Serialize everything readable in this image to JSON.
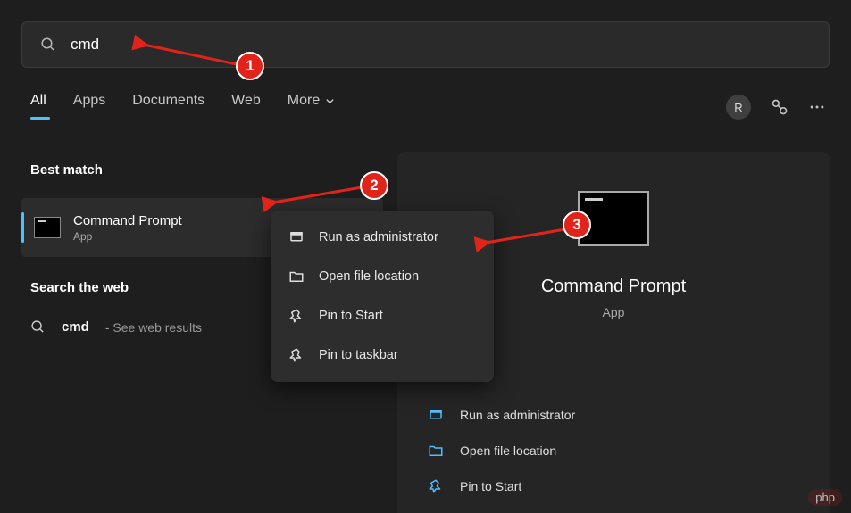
{
  "search": {
    "value": "cmd",
    "icon": "search-icon"
  },
  "tabs": {
    "items": [
      "All",
      "Apps",
      "Documents",
      "Web",
      "More"
    ],
    "active_index": 0
  },
  "header": {
    "avatar_initial": "R"
  },
  "best_match": {
    "label": "Best match",
    "title": "Command Prompt",
    "subtitle": "App"
  },
  "web_search": {
    "label": "Search the web",
    "term": "cmd",
    "hint": "- See web results"
  },
  "context_menu": {
    "items": [
      {
        "icon": "admin",
        "label": "Run as administrator"
      },
      {
        "icon": "folder",
        "label": "Open file location"
      },
      {
        "icon": "pin",
        "label": "Pin to Start"
      },
      {
        "icon": "pin",
        "label": "Pin to taskbar"
      }
    ]
  },
  "detail": {
    "title": "Command Prompt",
    "subtitle": "App",
    "actions": [
      {
        "icon": "admin",
        "label": "Run as administrator"
      },
      {
        "icon": "folder",
        "label": "Open file location"
      },
      {
        "icon": "pin",
        "label": "Pin to Start"
      }
    ]
  },
  "annotations": {
    "badge1": "1",
    "badge2": "2",
    "badge3": "3"
  },
  "watermark": "php"
}
